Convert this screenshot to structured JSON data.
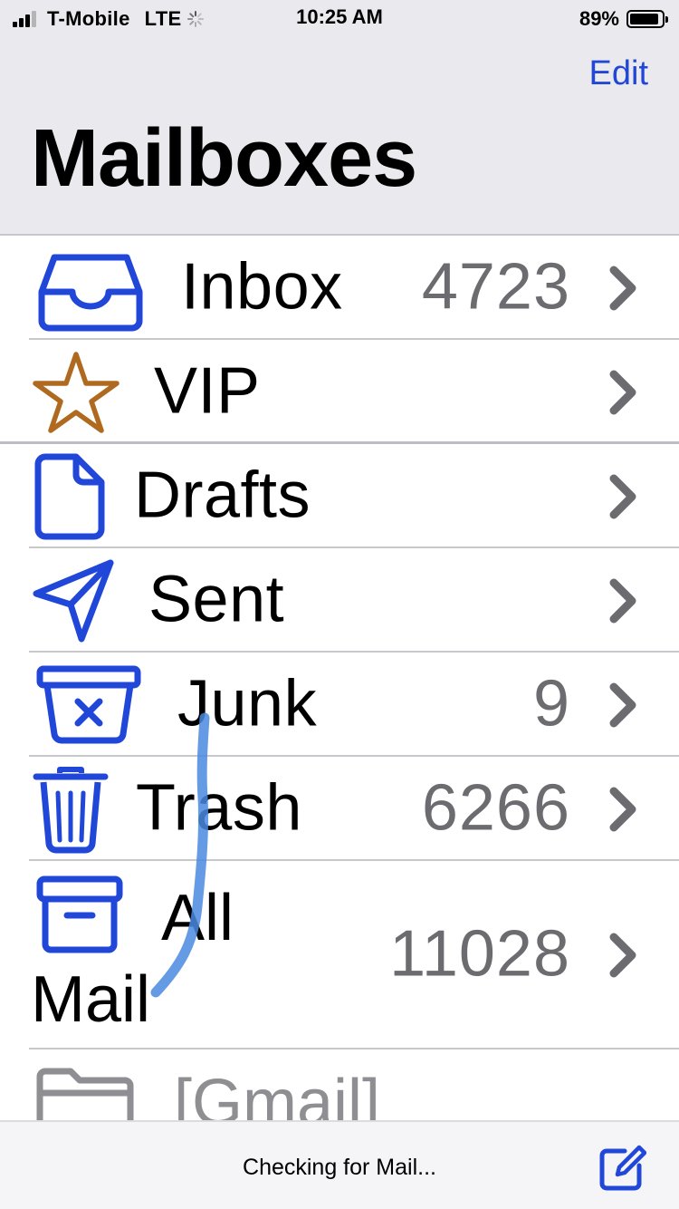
{
  "status_bar": {
    "carrier": "T-Mobile",
    "network": "LTE",
    "time": "10:25 AM",
    "battery_percent": "89%",
    "battery_level": 0.89,
    "signal_bars": 3
  },
  "nav": {
    "edit_label": "Edit",
    "title": "Mailboxes"
  },
  "mailboxes": [
    {
      "label": "Inbox",
      "count": "4723",
      "icon": "inbox-tray-icon"
    },
    {
      "label": "VIP",
      "count": "",
      "icon": "star-icon"
    },
    {
      "label": "Drafts",
      "count": "",
      "icon": "document-icon"
    },
    {
      "label": "Sent",
      "count": "",
      "icon": "paper-plane-icon"
    },
    {
      "label": "Junk",
      "count": "9",
      "icon": "junk-bin-icon"
    },
    {
      "label": "Trash",
      "count": "6266",
      "icon": "trash-can-icon"
    },
    {
      "label_line1": "All",
      "label_line2": "Mail",
      "count": "11028",
      "icon": "archive-box-icon"
    },
    {
      "label": "[Gmail]",
      "count": "",
      "icon": "folder-icon"
    }
  ],
  "toolbar": {
    "status": "Checking for Mail...",
    "compose_icon": "compose-icon"
  },
  "colors": {
    "accent": "#2147d8",
    "vip": "#b06a20",
    "count_gray": "#6c6c70",
    "chevron_gray": "#6c6c70",
    "header_bg": "#e9e9ee",
    "scribble": "#4a8ae0"
  }
}
